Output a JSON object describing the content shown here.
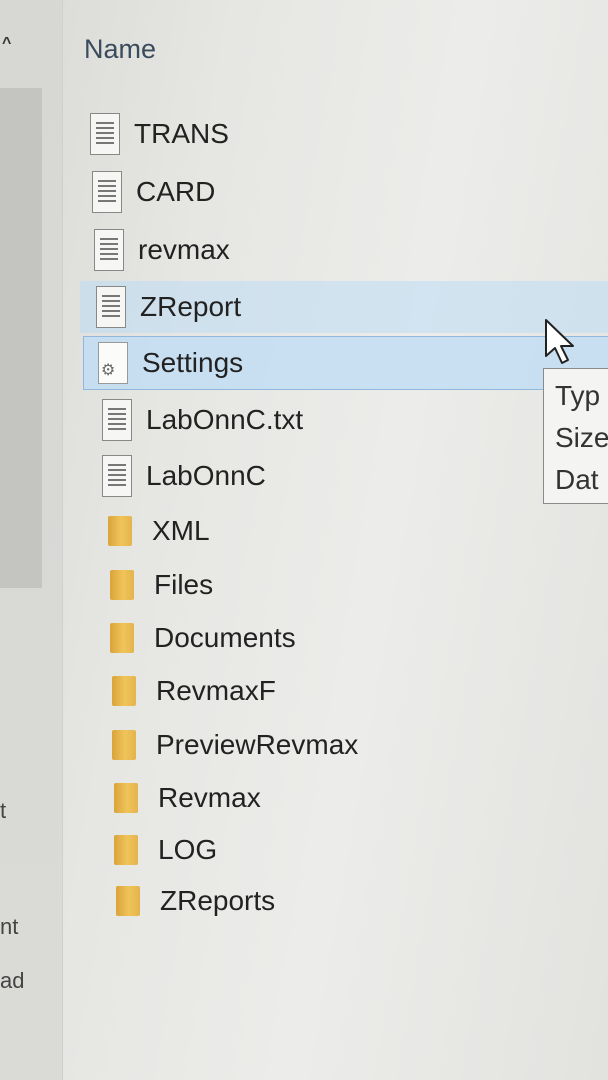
{
  "nav_pane": {
    "collapse_glyph": "^",
    "fragments": [
      "t",
      "nt",
      "ad"
    ]
  },
  "column_header": "Name",
  "files": [
    {
      "name": "TRANS",
      "icon": "document-icon"
    },
    {
      "name": "CARD",
      "icon": "document-icon"
    },
    {
      "name": "revmax",
      "icon": "document-icon"
    },
    {
      "name": "ZReport",
      "icon": "document-icon",
      "state": "hovered"
    },
    {
      "name": "Settings",
      "icon": "settings-file-icon",
      "state": "selected"
    },
    {
      "name": "LabOnnC.txt",
      "icon": "document-icon"
    },
    {
      "name": "LabOnnC",
      "icon": "document-icon"
    },
    {
      "name": "XML",
      "icon": "folder-icon"
    },
    {
      "name": "Files",
      "icon": "folder-icon"
    },
    {
      "name": "Documents",
      "icon": "folder-icon"
    },
    {
      "name": "RevmaxF",
      "icon": "folder-icon"
    },
    {
      "name": "PreviewRevmax",
      "icon": "folder-icon"
    },
    {
      "name": "Revmax",
      "icon": "folder-icon"
    },
    {
      "name": "LOG",
      "icon": "folder-icon"
    },
    {
      "name": "ZReports",
      "icon": "folder-icon"
    }
  ],
  "tooltip": {
    "type_label": "Typ",
    "size_label": "Size",
    "date_label": "Dat"
  },
  "colors": {
    "selection": "#bedcf5",
    "selection_border": "#8fb8dc",
    "folder": "#e9b84e"
  }
}
